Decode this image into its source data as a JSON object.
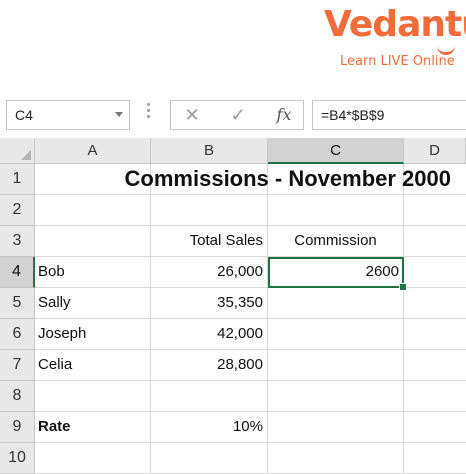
{
  "brand": {
    "name": "Vedantu",
    "tagline": "Learn LIVE Online"
  },
  "formula_bar": {
    "name_box": "C4",
    "cancel_icon": "✕",
    "enter_icon": "✓",
    "fx_label": "fx",
    "formula": "=B4*$B$9"
  },
  "columns": [
    "A",
    "B",
    "C",
    "D"
  ],
  "active_column": "C",
  "active_row": "4",
  "rows": [
    {
      "num": "1",
      "a": "",
      "b": "",
      "c": "",
      "title": "Commissions - November 2000"
    },
    {
      "num": "2",
      "a": "",
      "b": "",
      "c": ""
    },
    {
      "num": "3",
      "a": "",
      "b": "Total Sales",
      "c": "Commission"
    },
    {
      "num": "4",
      "a": "Bob",
      "b": "26,000",
      "c": "2600"
    },
    {
      "num": "5",
      "a": "Sally",
      "b": "35,350",
      "c": ""
    },
    {
      "num": "6",
      "a": "Joseph",
      "b": "42,000",
      "c": ""
    },
    {
      "num": "7",
      "a": "Celia",
      "b": "28,800",
      "c": ""
    },
    {
      "num": "8",
      "a": "",
      "b": "",
      "c": ""
    },
    {
      "num": "9",
      "a": "Rate",
      "b": "10%",
      "c": ""
    },
    {
      "num": "10",
      "a": "",
      "b": "",
      "c": ""
    }
  ],
  "colors": {
    "brand": "#f26b3a",
    "selection": "#217346",
    "header_bg": "#e8e8e8",
    "gridline": "#d9d9d9"
  }
}
